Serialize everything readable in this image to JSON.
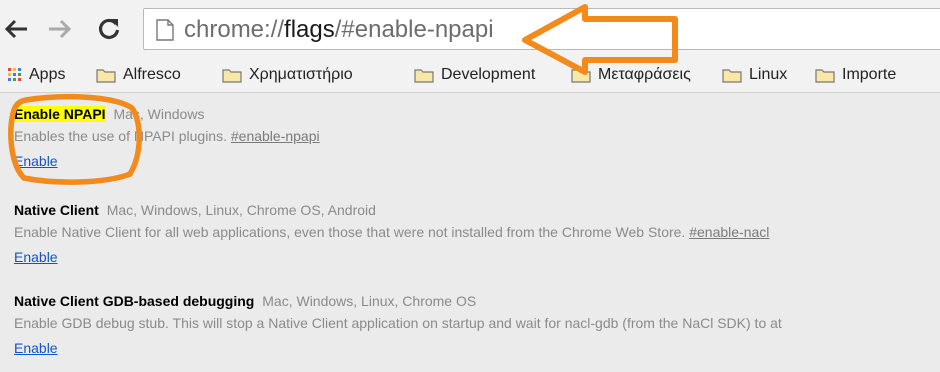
{
  "toolbar": {
    "back_icon": "back-arrow-icon",
    "forward_icon": "forward-arrow-icon",
    "reload_icon": "reload-icon",
    "url_scheme": "chrome://",
    "url_host": "flags",
    "url_path": "/#enable-npapi",
    "page_icon": "page-icon"
  },
  "bookmarks": {
    "items": [
      {
        "label": "Apps",
        "icon": "apps-grid-icon"
      },
      {
        "label": "Alfresco",
        "icon": "folder-icon"
      },
      {
        "label": "Χρηματιστήριο",
        "icon": "folder-icon"
      },
      {
        "label": "Development",
        "icon": "folder-icon"
      },
      {
        "label": "Μεταφράσεις",
        "icon": "folder-icon"
      },
      {
        "label": "Linux",
        "icon": "folder-icon"
      },
      {
        "label": "Importe",
        "icon": "folder-icon"
      }
    ]
  },
  "experiments": [
    {
      "name": "Enable NPAPI",
      "platforms": "Mac, Windows",
      "description": "Enables the use of NPAPI plugins. ",
      "tag": "#enable-npapi",
      "action": "Enable"
    },
    {
      "name": "Native Client",
      "platforms": "Mac, Windows, Linux, Chrome OS, Android",
      "description": "Enable Native Client for all web applications, even those that were not installed from the Chrome Web Store. ",
      "tag": "#enable-nacl",
      "action": "Enable"
    },
    {
      "name": "Native Client GDB-based debugging",
      "platforms": "Mac, Windows, Linux, Chrome OS",
      "description": "Enable GDB debug stub. This will stop a Native Client application on startup and wait for nacl-gdb (from the NaCl SDK) to at",
      "tag": "",
      "action": "Enable"
    }
  ],
  "annotations": {
    "color": "#f28a1c",
    "arrow_icon": "left-arrow-annotation",
    "circle_icon": "highlight-ellipse-annotation"
  }
}
